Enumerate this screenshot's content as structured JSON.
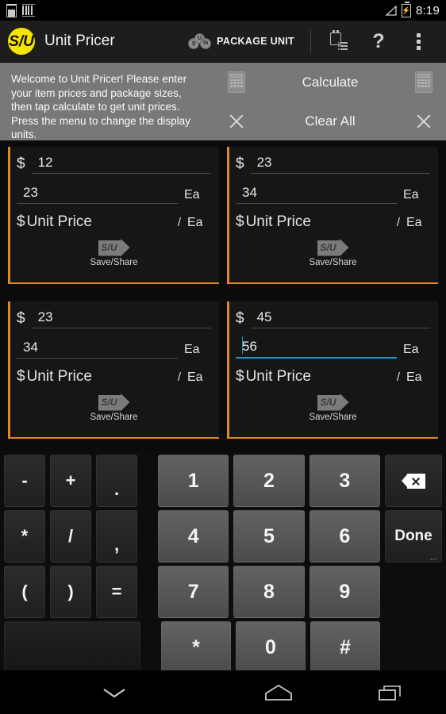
{
  "status_bar": {
    "icons": [
      "glass-icon",
      "barcode-icon",
      "signal-icon",
      "battery-charging-icon"
    ],
    "time": "8:19"
  },
  "action_bar": {
    "logo_text": "S/U",
    "title": "Unit Pricer",
    "unit_mode_label": "PACKAGE UNIT",
    "unit_coins": [
      "g",
      "U",
      "lb"
    ],
    "buttons": [
      {
        "name": "saved-list-button",
        "icon": "clipboard-list-icon"
      },
      {
        "name": "help-button",
        "icon": "question-mark-icon",
        "label": "?"
      },
      {
        "name": "overflow-menu-button",
        "icon": "more-vertical-icon"
      }
    ]
  },
  "welcome": {
    "message": "Welcome to Unit Pricer! Please enter your item prices and package sizes, then tap calculate to get unit prices. Press the menu to change the display units.",
    "calculate_label": "Calculate",
    "clear_all_label": "Clear All",
    "calc_icon": "calculator-icon",
    "clear_icon": "close-x-icon"
  },
  "accent_color": "#e08a20",
  "focus_color": "#2196c9",
  "items": [
    {
      "price": "12",
      "size": "23",
      "size_unit": "Ea",
      "unit_price_label": "Unit Price",
      "unit_price_unit": "Ea",
      "currency": "$",
      "divider": "/",
      "save_share_label": "Save/Share",
      "save_share_icon_text": "S/U",
      "focused_field": ""
    },
    {
      "price": "23",
      "size": "34",
      "size_unit": "Ea",
      "unit_price_label": "Unit Price",
      "unit_price_unit": "Ea",
      "currency": "$",
      "divider": "/",
      "save_share_label": "Save/Share",
      "save_share_icon_text": "S/U",
      "focused_field": ""
    },
    {
      "price": "23",
      "size": "34",
      "size_unit": "Ea",
      "unit_price_label": "Unit Price",
      "unit_price_unit": "Ea",
      "currency": "$",
      "divider": "/",
      "save_share_label": "Save/Share",
      "save_share_icon_text": "S/U",
      "focused_field": ""
    },
    {
      "price": "45",
      "size": "56",
      "size_unit": "Ea",
      "unit_price_label": "Unit Price",
      "unit_price_unit": "Ea",
      "currency": "$",
      "divider": "/",
      "save_share_label": "Save/Share",
      "save_share_icon_text": "S/U",
      "focused_field": "size"
    }
  ],
  "keyboard": {
    "type": "numeric-calculator",
    "rows": [
      {
        "ops": [
          "-",
          "+",
          "."
        ],
        "nums": [
          "1",
          "2",
          "3"
        ],
        "side": "backspace-icon",
        "side_label": ""
      },
      {
        "ops": [
          "*",
          "/",
          ","
        ],
        "nums": [
          "4",
          "5",
          "6"
        ],
        "side": "done-key",
        "side_label": "Done"
      },
      {
        "ops": [
          "(",
          ")",
          "="
        ],
        "nums": [
          "7",
          "8",
          "9"
        ],
        "side": "",
        "side_label": ""
      },
      {
        "ops": [
          ""
        ],
        "nums": [
          "*",
          "0",
          "#"
        ],
        "side": "",
        "side_label": ""
      }
    ]
  },
  "nav_bar": {
    "buttons": [
      {
        "name": "hide-keyboard-button",
        "icon": "chevron-down-icon"
      },
      {
        "name": "home-button",
        "icon": "home-pentagon-icon"
      },
      {
        "name": "recents-button",
        "icon": "recents-squares-icon"
      }
    ]
  }
}
